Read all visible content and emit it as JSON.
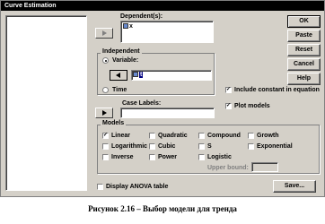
{
  "window": {
    "title": "Curve Estimation"
  },
  "dependent": {
    "label": "Dependent(s):",
    "value": "x"
  },
  "independent": {
    "title": "Independent",
    "variable_label": "Variable:",
    "variable_value": "t",
    "time_label": "Time",
    "selected": "variable"
  },
  "case_labels": {
    "label": "Case Labels:",
    "value": ""
  },
  "options": {
    "include_constant": {
      "label": "Include constant in equation",
      "checked": true
    },
    "plot_models": {
      "label": "Plot models",
      "checked": true
    }
  },
  "models": {
    "title": "Models",
    "items": [
      {
        "label": "Linear",
        "checked": true
      },
      {
        "label": "Quadratic",
        "checked": false
      },
      {
        "label": "Compound",
        "checked": false
      },
      {
        "label": "Growth",
        "checked": false
      },
      {
        "label": "Logarithmic",
        "checked": false
      },
      {
        "label": "Cubic",
        "checked": false
      },
      {
        "label": "S",
        "checked": false
      },
      {
        "label": "Exponential",
        "checked": false
      },
      {
        "label": "Inverse",
        "checked": false
      },
      {
        "label": "Power",
        "checked": false
      },
      {
        "label": "Logistic",
        "checked": false
      }
    ],
    "upper_bound_label": "Upper bound:",
    "upper_bound_value": ""
  },
  "display_anova": {
    "label": "Display ANOVA table",
    "checked": false
  },
  "buttons": {
    "ok": "OK",
    "paste": "Paste",
    "reset": "Reset",
    "cancel": "Cancel",
    "help": "Help",
    "save": "Save..."
  },
  "caption": "Рисунок 2.16 – Выбор модели для тренда"
}
